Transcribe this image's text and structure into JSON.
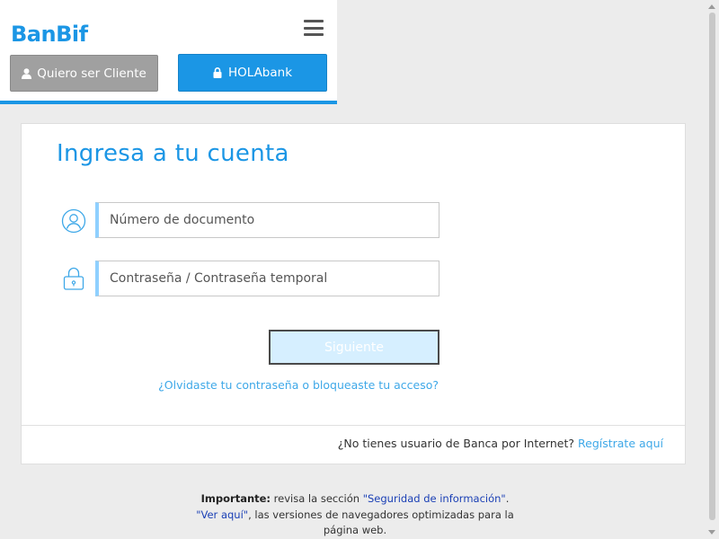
{
  "header": {
    "logo": "BanBif",
    "cliente_button": "Quiero ser Cliente",
    "holabank_button": "HOLAbank"
  },
  "login": {
    "title": "Ingresa a tu cuenta",
    "document_placeholder": "Número de documento",
    "password_placeholder": "Contraseña / Contraseña temporal",
    "submit_label": "Siguiente",
    "forgot_link": "¿Olvidaste tu contraseña o bloqueaste tu acceso?",
    "no_user_text": "¿No tienes usuario de Banca por Internet?",
    "register_link": "Regístrate aquí"
  },
  "footer": {
    "important_label": "Importante:",
    "text_1": " revisa la sección ",
    "link_1": "\"Seguridad de información\"",
    "text_2": ".",
    "link_2": "\"Ver aquí\"",
    "text_3": ", las versiones de navegadores optimizadas para la página web."
  },
  "colors": {
    "brand_blue": "#1b96e5",
    "link_blue": "#3ea8e8",
    "input_accent": "#8fd0ff"
  }
}
